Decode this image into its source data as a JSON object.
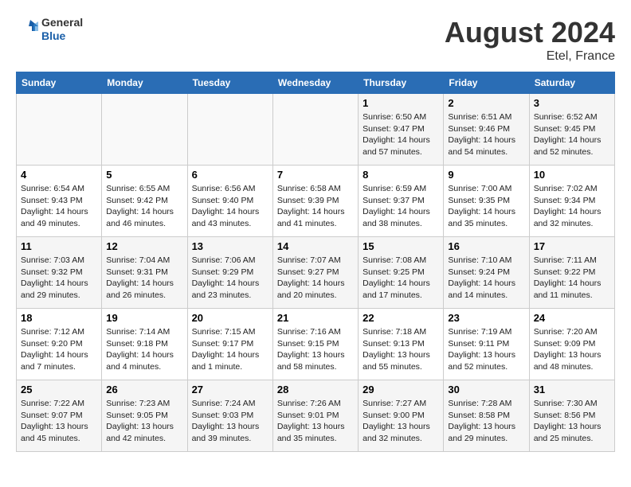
{
  "header": {
    "logo_line1": "General",
    "logo_line2": "Blue",
    "month_year": "August 2024",
    "location": "Etel, France"
  },
  "weekdays": [
    "Sunday",
    "Monday",
    "Tuesday",
    "Wednesday",
    "Thursday",
    "Friday",
    "Saturday"
  ],
  "weeks": [
    [
      {
        "day": "",
        "info": ""
      },
      {
        "day": "",
        "info": ""
      },
      {
        "day": "",
        "info": ""
      },
      {
        "day": "",
        "info": ""
      },
      {
        "day": "1",
        "info": "Sunrise: 6:50 AM\nSunset: 9:47 PM\nDaylight: 14 hours\nand 57 minutes."
      },
      {
        "day": "2",
        "info": "Sunrise: 6:51 AM\nSunset: 9:46 PM\nDaylight: 14 hours\nand 54 minutes."
      },
      {
        "day": "3",
        "info": "Sunrise: 6:52 AM\nSunset: 9:45 PM\nDaylight: 14 hours\nand 52 minutes."
      }
    ],
    [
      {
        "day": "4",
        "info": "Sunrise: 6:54 AM\nSunset: 9:43 PM\nDaylight: 14 hours\nand 49 minutes."
      },
      {
        "day": "5",
        "info": "Sunrise: 6:55 AM\nSunset: 9:42 PM\nDaylight: 14 hours\nand 46 minutes."
      },
      {
        "day": "6",
        "info": "Sunrise: 6:56 AM\nSunset: 9:40 PM\nDaylight: 14 hours\nand 43 minutes."
      },
      {
        "day": "7",
        "info": "Sunrise: 6:58 AM\nSunset: 9:39 PM\nDaylight: 14 hours\nand 41 minutes."
      },
      {
        "day": "8",
        "info": "Sunrise: 6:59 AM\nSunset: 9:37 PM\nDaylight: 14 hours\nand 38 minutes."
      },
      {
        "day": "9",
        "info": "Sunrise: 7:00 AM\nSunset: 9:35 PM\nDaylight: 14 hours\nand 35 minutes."
      },
      {
        "day": "10",
        "info": "Sunrise: 7:02 AM\nSunset: 9:34 PM\nDaylight: 14 hours\nand 32 minutes."
      }
    ],
    [
      {
        "day": "11",
        "info": "Sunrise: 7:03 AM\nSunset: 9:32 PM\nDaylight: 14 hours\nand 29 minutes."
      },
      {
        "day": "12",
        "info": "Sunrise: 7:04 AM\nSunset: 9:31 PM\nDaylight: 14 hours\nand 26 minutes."
      },
      {
        "day": "13",
        "info": "Sunrise: 7:06 AM\nSunset: 9:29 PM\nDaylight: 14 hours\nand 23 minutes."
      },
      {
        "day": "14",
        "info": "Sunrise: 7:07 AM\nSunset: 9:27 PM\nDaylight: 14 hours\nand 20 minutes."
      },
      {
        "day": "15",
        "info": "Sunrise: 7:08 AM\nSunset: 9:25 PM\nDaylight: 14 hours\nand 17 minutes."
      },
      {
        "day": "16",
        "info": "Sunrise: 7:10 AM\nSunset: 9:24 PM\nDaylight: 14 hours\nand 14 minutes."
      },
      {
        "day": "17",
        "info": "Sunrise: 7:11 AM\nSunset: 9:22 PM\nDaylight: 14 hours\nand 11 minutes."
      }
    ],
    [
      {
        "day": "18",
        "info": "Sunrise: 7:12 AM\nSunset: 9:20 PM\nDaylight: 14 hours\nand 7 minutes."
      },
      {
        "day": "19",
        "info": "Sunrise: 7:14 AM\nSunset: 9:18 PM\nDaylight: 14 hours\nand 4 minutes."
      },
      {
        "day": "20",
        "info": "Sunrise: 7:15 AM\nSunset: 9:17 PM\nDaylight: 14 hours\nand 1 minute."
      },
      {
        "day": "21",
        "info": "Sunrise: 7:16 AM\nSunset: 9:15 PM\nDaylight: 13 hours\nand 58 minutes."
      },
      {
        "day": "22",
        "info": "Sunrise: 7:18 AM\nSunset: 9:13 PM\nDaylight: 13 hours\nand 55 minutes."
      },
      {
        "day": "23",
        "info": "Sunrise: 7:19 AM\nSunset: 9:11 PM\nDaylight: 13 hours\nand 52 minutes."
      },
      {
        "day": "24",
        "info": "Sunrise: 7:20 AM\nSunset: 9:09 PM\nDaylight: 13 hours\nand 48 minutes."
      }
    ],
    [
      {
        "day": "25",
        "info": "Sunrise: 7:22 AM\nSunset: 9:07 PM\nDaylight: 13 hours\nand 45 minutes."
      },
      {
        "day": "26",
        "info": "Sunrise: 7:23 AM\nSunset: 9:05 PM\nDaylight: 13 hours\nand 42 minutes."
      },
      {
        "day": "27",
        "info": "Sunrise: 7:24 AM\nSunset: 9:03 PM\nDaylight: 13 hours\nand 39 minutes."
      },
      {
        "day": "28",
        "info": "Sunrise: 7:26 AM\nSunset: 9:01 PM\nDaylight: 13 hours\nand 35 minutes."
      },
      {
        "day": "29",
        "info": "Sunrise: 7:27 AM\nSunset: 9:00 PM\nDaylight: 13 hours\nand 32 minutes."
      },
      {
        "day": "30",
        "info": "Sunrise: 7:28 AM\nSunset: 8:58 PM\nDaylight: 13 hours\nand 29 minutes."
      },
      {
        "day": "31",
        "info": "Sunrise: 7:30 AM\nSunset: 8:56 PM\nDaylight: 13 hours\nand 25 minutes."
      }
    ]
  ]
}
